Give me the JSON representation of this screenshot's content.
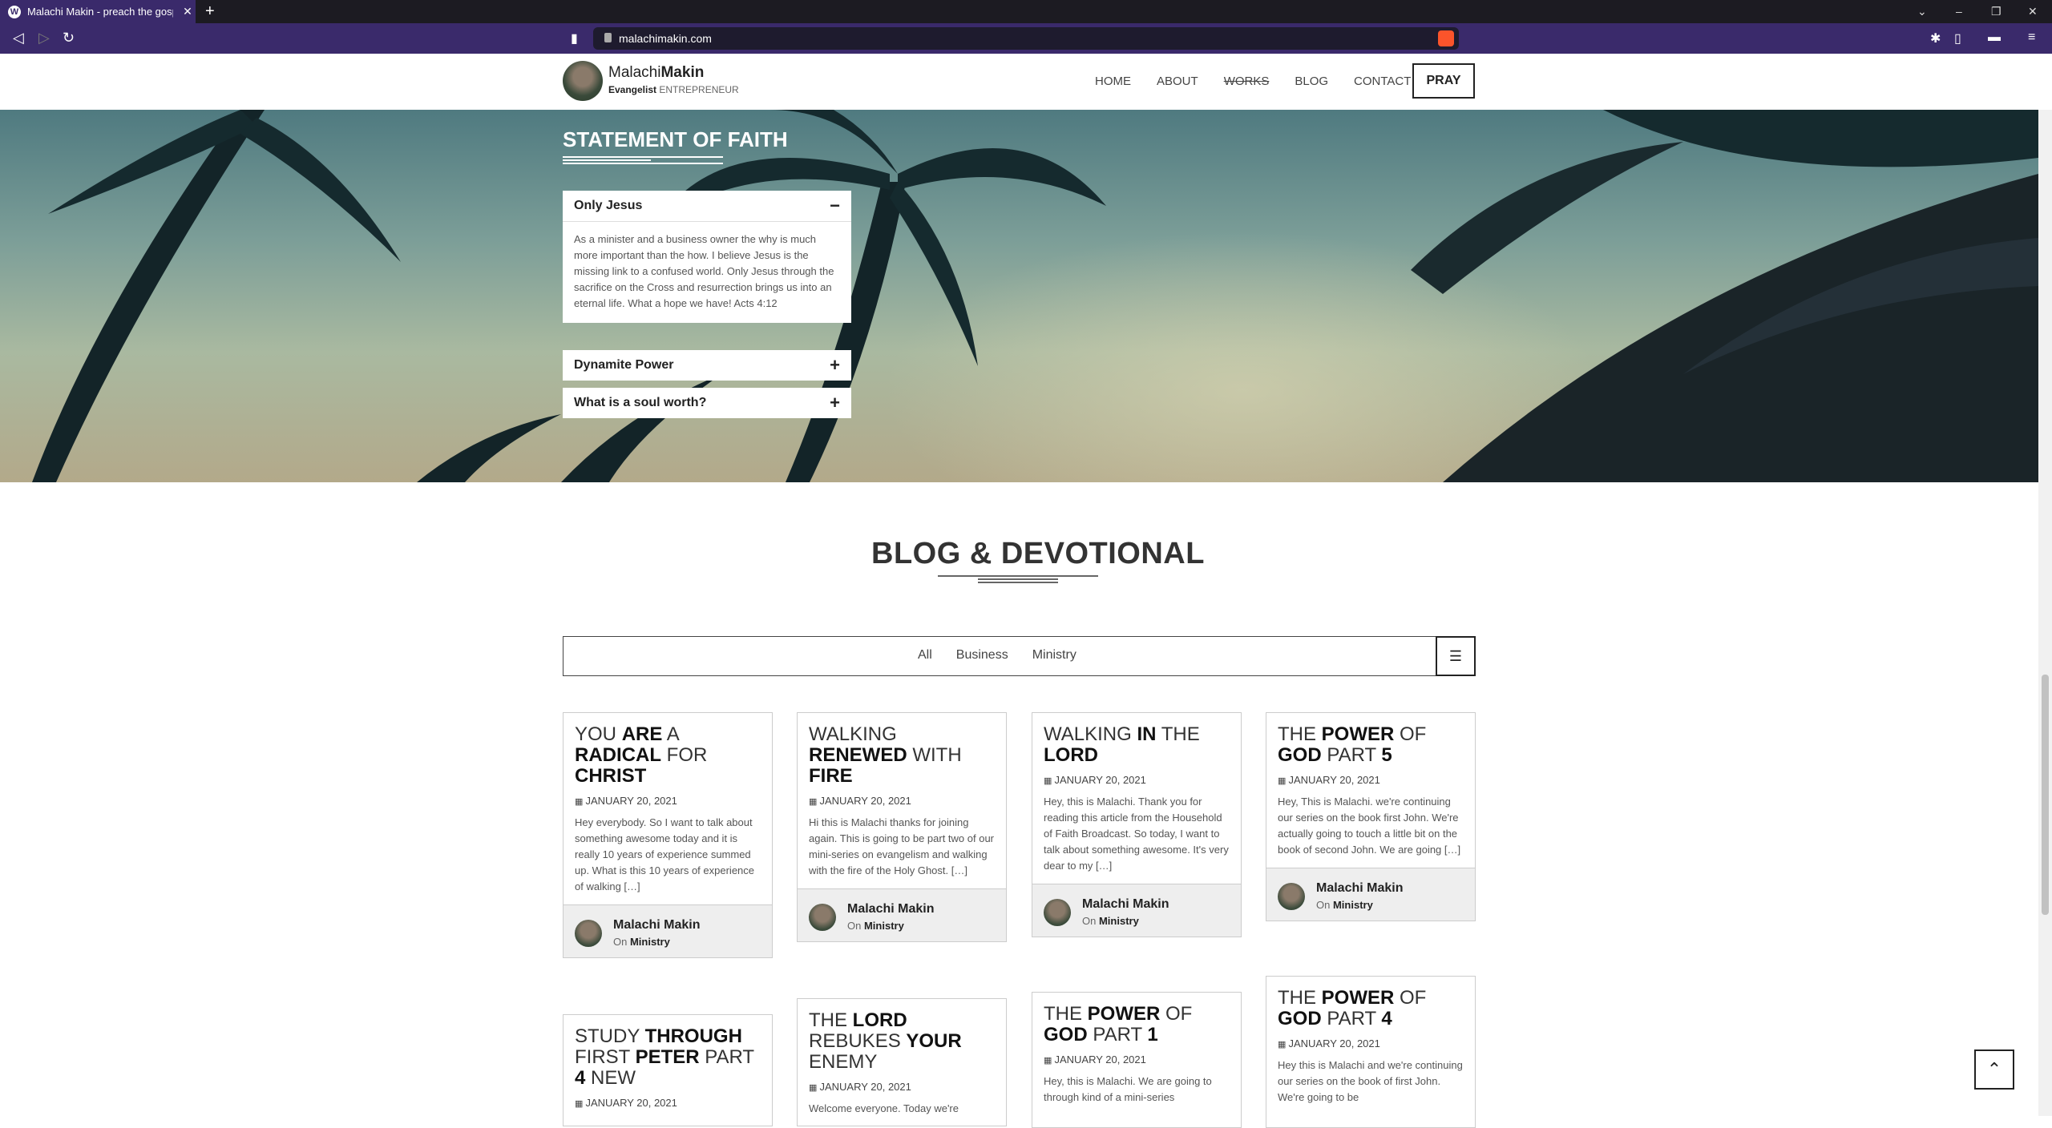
{
  "browser": {
    "tab_title": "Malachi Makin - preach the gosp",
    "tab_icon": "wordpress-icon",
    "url": "malachimakin.com"
  },
  "header": {
    "name_first": "Malachi",
    "name_last": "Makin",
    "tag_bold": "Evangelist",
    "tag_rest": "ENTREPRENEUR",
    "nav": [
      "HOME",
      "ABOUT",
      "WORKS",
      "BLOG",
      "CONTACT"
    ],
    "pray": "PRAY"
  },
  "hero": {
    "title": "STATEMENT OF FAITH",
    "accordion": [
      {
        "title": "Only Jesus",
        "toggle": "−",
        "body": "As a minister and a business owner the why is much more important than the how. I believe Jesus is the missing link to a confused world. Only Jesus through the sacrifice on the Cross and resurrection brings us into an eternal life. What a hope we have! Acts 4:12"
      },
      {
        "title": "Dynamite Power",
        "toggle": "+"
      },
      {
        "title": "What is a soul worth?",
        "toggle": "+"
      }
    ]
  },
  "blog": {
    "title": "BLOG & DEVOTIONAL",
    "filters": [
      "All",
      "Business",
      "Ministry"
    ],
    "author": "Malachi Makin",
    "on": "On",
    "category": "Ministry",
    "cards": [
      {
        "t1": "YOU ",
        "b1": "ARE",
        "t2": " A ",
        "b2": "RADICAL",
        "t3": " FOR ",
        "b3": "CHRIST",
        "t4": "",
        "date": "JANUARY 20, 2021",
        "excerpt": "Hey everybody. So I want to talk about something awesome today and it is really 10 years of experience summed up. What is this 10 years of experience of walking […]"
      },
      {
        "t1": "WALKING ",
        "b1": "RENEWED",
        "t2": " WITH ",
        "b2": "FIRE",
        "t3": "",
        "b3": "",
        "t4": "",
        "date": "JANUARY 20, 2021",
        "excerpt": "Hi this is Malachi thanks for joining again. This is going to be part two of our mini-series on evangelism and walking with the fire of the Holy Ghost.  […]"
      },
      {
        "t1": "WALKING ",
        "b1": "IN",
        "t2": " THE ",
        "b2": "LORD",
        "t3": "",
        "b3": "",
        "t4": "",
        "date": "JANUARY 20, 2021",
        "excerpt": "Hey, this is Malachi. Thank you for reading this article from the Household of Faith Broadcast. So today, I want to talk about something awesome. It's very dear to my […]"
      },
      {
        "t1": "THE ",
        "b1": "POWER",
        "t2": " OF ",
        "b2": "GOD",
        "t3": " PART ",
        "b3": "5",
        "t4": "",
        "date": "JANUARY 20, 2021",
        "excerpt": "Hey, This is Malachi. we're continuing our series on the book first John. We're actually going to touch a little bit on the book of second John. We are going […]"
      },
      {
        "t1": "STUDY ",
        "b1": "THROUGH",
        "t2": " FIRST ",
        "b2": "PETER",
        "t3": " PART ",
        "b3": "4",
        "t4": " NEW",
        "date": "JANUARY 20, 2021",
        "excerpt": ""
      },
      {
        "t1": "THE ",
        "b1": "LORD",
        "t2": " REBUKES ",
        "b2": "YOUR",
        "t3": " ENEMY",
        "b3": "",
        "t4": "",
        "date": "JANUARY 20, 2021",
        "excerpt": "Welcome everyone. Today we're"
      },
      {
        "t1": "THE ",
        "b1": "POWER",
        "t2": " OF ",
        "b2": "GOD",
        "t3": " PART ",
        "b3": "1",
        "t4": "",
        "date": "JANUARY 20, 2021",
        "excerpt": "Hey, this is Malachi. We are going to  through kind of a mini-series"
      },
      {
        "t1": "THE ",
        "b1": "POWER",
        "t2": " OF ",
        "b2": "GOD",
        "t3": " PART ",
        "b3": "4",
        "t4": "",
        "date": "JANUARY 20, 2021",
        "excerpt": "Hey this is Malachi and we're continuing our series on the book of first John. We're going to be"
      }
    ]
  },
  "back_to_top_icon": "chevron-up-icon"
}
